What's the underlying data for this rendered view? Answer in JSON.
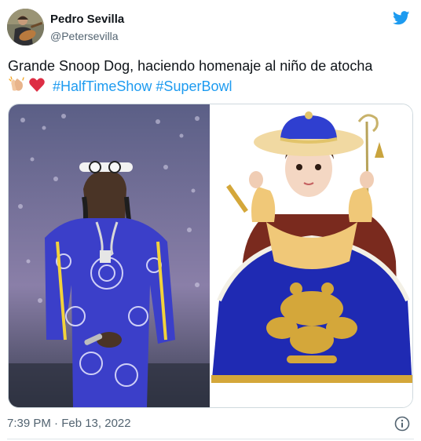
{
  "tweet": {
    "author": {
      "display_name": "Pedro Sevilla",
      "handle": "@Petersevilla",
      "avatar_icon": "avatar-guitarist"
    },
    "logo_icon": "twitter-bird-icon",
    "text": {
      "line1": "Grande Snoop Dog, haciendo homenaje al niño de atocha",
      "emojis": [
        "clapping-hands-icon",
        "red-heart-icon"
      ],
      "hashtags": [
        "#HalfTimeShow",
        "#SuperBowl"
      ]
    },
    "media": {
      "left_image": "snoop-dogg-blue-bandana-outfit",
      "right_image": "santo-nino-de-atocha-statue"
    },
    "timestamp": "7:39 PM · Feb 13, 2022",
    "info_icon": "info-icon",
    "colors": {
      "link": "#1d9bf0",
      "secondary_text": "#536471",
      "primary_text": "#0f1419"
    }
  }
}
